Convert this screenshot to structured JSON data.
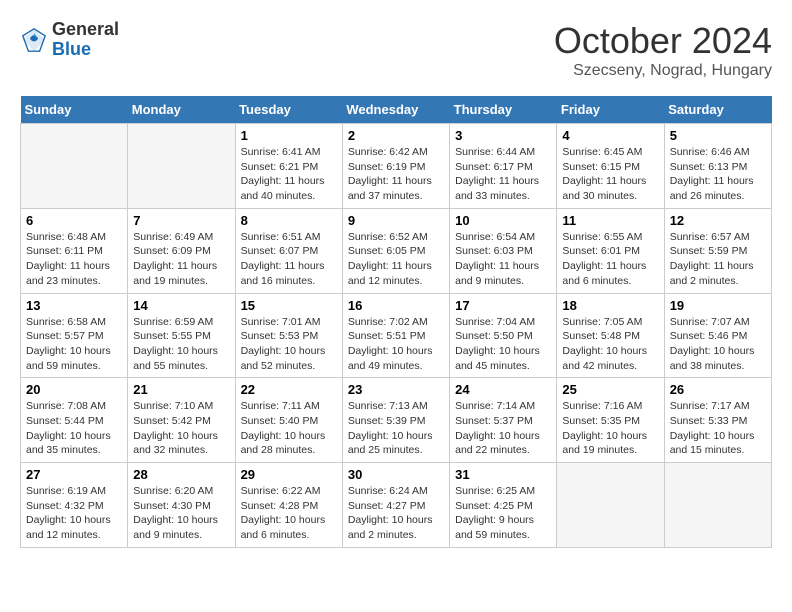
{
  "header": {
    "logo_line1": "General",
    "logo_line2": "Blue",
    "month_title": "October 2024",
    "location": "Szecseny, Nograd, Hungary"
  },
  "days_of_week": [
    "Sunday",
    "Monday",
    "Tuesday",
    "Wednesday",
    "Thursday",
    "Friday",
    "Saturday"
  ],
  "weeks": [
    [
      {
        "day": null
      },
      {
        "day": null
      },
      {
        "day": "1",
        "sunrise": "6:41 AM",
        "sunset": "6:21 PM",
        "daylight": "11 hours and 40 minutes."
      },
      {
        "day": "2",
        "sunrise": "6:42 AM",
        "sunset": "6:19 PM",
        "daylight": "11 hours and 37 minutes."
      },
      {
        "day": "3",
        "sunrise": "6:44 AM",
        "sunset": "6:17 PM",
        "daylight": "11 hours and 33 minutes."
      },
      {
        "day": "4",
        "sunrise": "6:45 AM",
        "sunset": "6:15 PM",
        "daylight": "11 hours and 30 minutes."
      },
      {
        "day": "5",
        "sunrise": "6:46 AM",
        "sunset": "6:13 PM",
        "daylight": "11 hours and 26 minutes."
      }
    ],
    [
      {
        "day": "6",
        "sunrise": "6:48 AM",
        "sunset": "6:11 PM",
        "daylight": "11 hours and 23 minutes."
      },
      {
        "day": "7",
        "sunrise": "6:49 AM",
        "sunset": "6:09 PM",
        "daylight": "11 hours and 19 minutes."
      },
      {
        "day": "8",
        "sunrise": "6:51 AM",
        "sunset": "6:07 PM",
        "daylight": "11 hours and 16 minutes."
      },
      {
        "day": "9",
        "sunrise": "6:52 AM",
        "sunset": "6:05 PM",
        "daylight": "11 hours and 12 minutes."
      },
      {
        "day": "10",
        "sunrise": "6:54 AM",
        "sunset": "6:03 PM",
        "daylight": "11 hours and 9 minutes."
      },
      {
        "day": "11",
        "sunrise": "6:55 AM",
        "sunset": "6:01 PM",
        "daylight": "11 hours and 6 minutes."
      },
      {
        "day": "12",
        "sunrise": "6:57 AM",
        "sunset": "5:59 PM",
        "daylight": "11 hours and 2 minutes."
      }
    ],
    [
      {
        "day": "13",
        "sunrise": "6:58 AM",
        "sunset": "5:57 PM",
        "daylight": "10 hours and 59 minutes."
      },
      {
        "day": "14",
        "sunrise": "6:59 AM",
        "sunset": "5:55 PM",
        "daylight": "10 hours and 55 minutes."
      },
      {
        "day": "15",
        "sunrise": "7:01 AM",
        "sunset": "5:53 PM",
        "daylight": "10 hours and 52 minutes."
      },
      {
        "day": "16",
        "sunrise": "7:02 AM",
        "sunset": "5:51 PM",
        "daylight": "10 hours and 49 minutes."
      },
      {
        "day": "17",
        "sunrise": "7:04 AM",
        "sunset": "5:50 PM",
        "daylight": "10 hours and 45 minutes."
      },
      {
        "day": "18",
        "sunrise": "7:05 AM",
        "sunset": "5:48 PM",
        "daylight": "10 hours and 42 minutes."
      },
      {
        "day": "19",
        "sunrise": "7:07 AM",
        "sunset": "5:46 PM",
        "daylight": "10 hours and 38 minutes."
      }
    ],
    [
      {
        "day": "20",
        "sunrise": "7:08 AM",
        "sunset": "5:44 PM",
        "daylight": "10 hours and 35 minutes."
      },
      {
        "day": "21",
        "sunrise": "7:10 AM",
        "sunset": "5:42 PM",
        "daylight": "10 hours and 32 minutes."
      },
      {
        "day": "22",
        "sunrise": "7:11 AM",
        "sunset": "5:40 PM",
        "daylight": "10 hours and 28 minutes."
      },
      {
        "day": "23",
        "sunrise": "7:13 AM",
        "sunset": "5:39 PM",
        "daylight": "10 hours and 25 minutes."
      },
      {
        "day": "24",
        "sunrise": "7:14 AM",
        "sunset": "5:37 PM",
        "daylight": "10 hours and 22 minutes."
      },
      {
        "day": "25",
        "sunrise": "7:16 AM",
        "sunset": "5:35 PM",
        "daylight": "10 hours and 19 minutes."
      },
      {
        "day": "26",
        "sunrise": "7:17 AM",
        "sunset": "5:33 PM",
        "daylight": "10 hours and 15 minutes."
      }
    ],
    [
      {
        "day": "27",
        "sunrise": "6:19 AM",
        "sunset": "4:32 PM",
        "daylight": "10 hours and 12 minutes."
      },
      {
        "day": "28",
        "sunrise": "6:20 AM",
        "sunset": "4:30 PM",
        "daylight": "10 hours and 9 minutes."
      },
      {
        "day": "29",
        "sunrise": "6:22 AM",
        "sunset": "4:28 PM",
        "daylight": "10 hours and 6 minutes."
      },
      {
        "day": "30",
        "sunrise": "6:24 AM",
        "sunset": "4:27 PM",
        "daylight": "10 hours and 2 minutes."
      },
      {
        "day": "31",
        "sunrise": "6:25 AM",
        "sunset": "4:25 PM",
        "daylight": "9 hours and 59 minutes."
      },
      {
        "day": null
      },
      {
        "day": null
      }
    ]
  ],
  "labels": {
    "sunrise": "Sunrise:",
    "sunset": "Sunset:",
    "daylight": "Daylight:"
  }
}
